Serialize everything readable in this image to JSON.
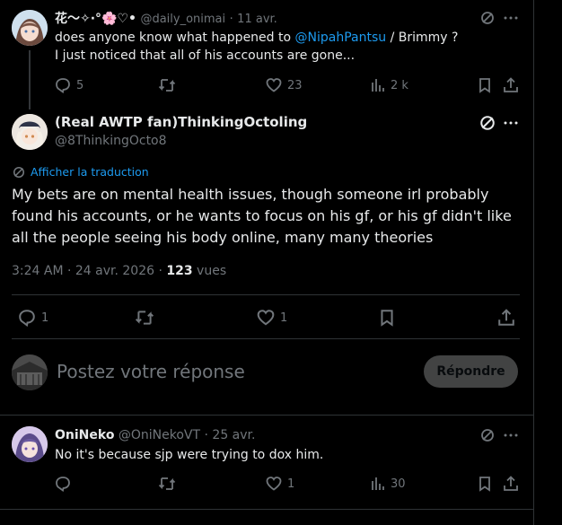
{
  "tweet1": {
    "display_name": "花〜✧·°🌸♡•",
    "handle": "@daily_onimai",
    "sep": "·",
    "time": "11 avr.",
    "text_prefix": "does anyone know what happened to ",
    "mention": "@NipahPantsu",
    "text_suffix": " / Brimmy ?",
    "text_line2": "I just noticed that all of his accounts are gone...",
    "replies": "5",
    "likes": "23",
    "views": "2 k"
  },
  "main": {
    "display_name": "(Real AWTP fan)ThinkingOctoling",
    "handle": "@8ThinkingOcto8",
    "translate": "Afficher la traduction",
    "text": "My bets are on mental health issues, though someone irl probably found his accounts, or he wants to focus on his gf, or his gf didn't like all the people seeing his body online, many many theories",
    "time": "3:24 AM · 24 avr. 2026 · ",
    "views_count": "123",
    "views_label": " vues",
    "replies": "1",
    "likes": "1"
  },
  "reply_box": {
    "placeholder": "Postez votre réponse",
    "button": "Répondre"
  },
  "tweet3": {
    "display_name": "OniNeko",
    "handle": "@OniNekoVT",
    "sep": "·",
    "time": "25 avr.",
    "text": "No it's because sjp were trying to dox him.",
    "likes": "1",
    "views": "30"
  },
  "colors": {
    "accent": "#1d9bf0",
    "muted": "#71767b",
    "border": "#2f3336",
    "reply_button_bg": "#787a7a"
  }
}
